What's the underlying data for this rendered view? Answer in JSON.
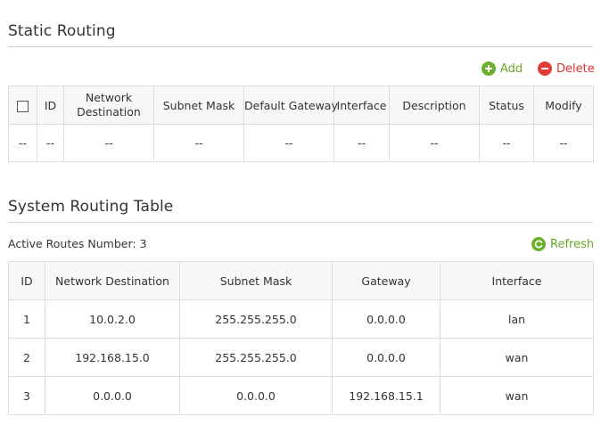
{
  "static_routing": {
    "title": "Static Routing",
    "add_label": "Add",
    "delete_label": "Delete",
    "columns": [
      "",
      "ID",
      "Network Destination",
      "Subnet Mask",
      "Default Gateway",
      "Interface",
      "Description",
      "Status",
      "Modify"
    ],
    "column_network_line1": "Network",
    "column_network_line2": "Destination",
    "rows": [
      [
        "--",
        "--",
        "--",
        "--",
        "--",
        "--",
        "--",
        "--",
        "--"
      ]
    ]
  },
  "system_routing": {
    "title": "System Routing Table",
    "active_routes_label": "Active Routes Number:",
    "active_routes_count": "3",
    "refresh_label": "Refresh",
    "columns": [
      "ID",
      "Network Destination",
      "Subnet Mask",
      "Gateway",
      "Interface"
    ],
    "rows": [
      [
        "1",
        "10.0.2.0",
        "255.255.255.0",
        "0.0.0.0",
        "lan"
      ],
      [
        "2",
        "192.168.15.0",
        "255.255.255.0",
        "0.0.0.0",
        "wan"
      ],
      [
        "3",
        "0.0.0.0",
        "0.0.0.0",
        "192.168.15.1",
        "wan"
      ]
    ]
  },
  "colors": {
    "add_green": "#6bb02b",
    "delete_red": "#e53b36",
    "header_bg": "#f7f7f7",
    "border": "#dcdcdc"
  },
  "icons": {
    "add": "plus-circle-icon",
    "delete": "minus-circle-icon",
    "refresh": "refresh-icon"
  }
}
